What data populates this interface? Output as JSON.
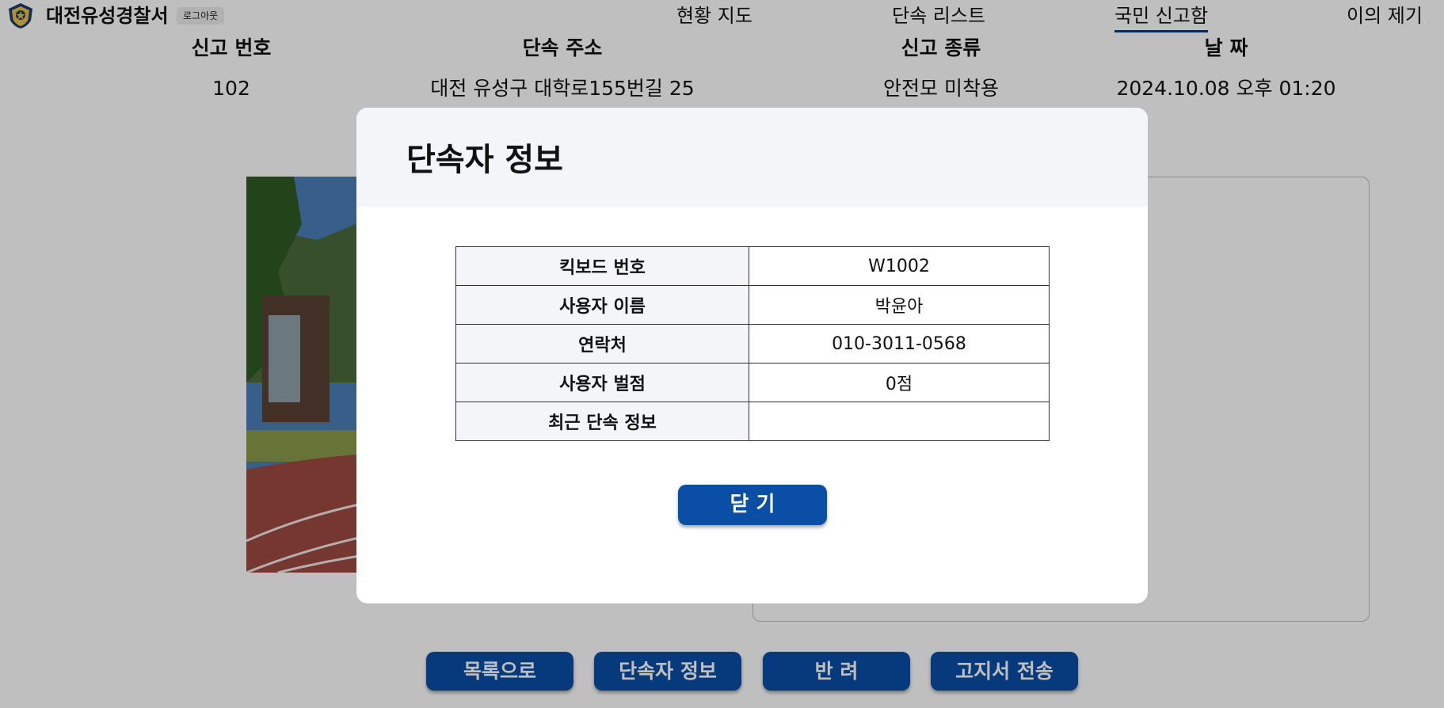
{
  "header": {
    "brand": "대전유성경찰서",
    "logout_label": "로그아웃",
    "nav": [
      {
        "label": "현황 지도"
      },
      {
        "label": "단속 리스트"
      },
      {
        "label": "국민 신고함",
        "active": true
      },
      {
        "label": "이의 제기"
      }
    ]
  },
  "report": {
    "columns": [
      "신고 번호",
      "단속 주소",
      "신고 종류",
      "날 짜"
    ],
    "values": [
      "102",
      "대전 유성구 대학로155번길 25",
      "안전모 미착용",
      "2024.10.08 오후 01:20"
    ]
  },
  "actions": [
    "목록으로",
    "단속자 정보",
    "반 려",
    "고지서 전송"
  ],
  "modal": {
    "title": "단속자 정보",
    "rows": [
      {
        "label": "킥보드 번호",
        "value": "W1002"
      },
      {
        "label": "사용자 이름",
        "value": "박윤아"
      },
      {
        "label": "연락처",
        "value": "010-3011-0568"
      },
      {
        "label": "사용자 벌점",
        "value": "0점"
      },
      {
        "label": "최근 단속 정보",
        "value": ""
      }
    ],
    "close_label": "닫 기"
  },
  "colors": {
    "accent": "#0a4ea6",
    "modal_header_bg": "#f3f5f9",
    "overlay": "rgba(0,0,0,0.25)"
  },
  "icons": {
    "logo": "police-badge-icon"
  }
}
